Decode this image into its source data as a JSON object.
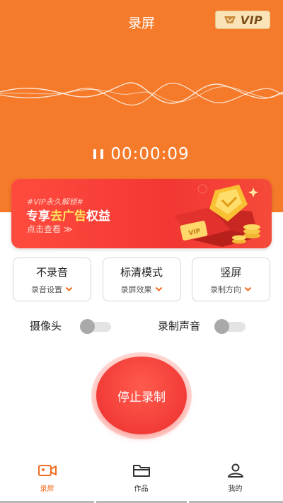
{
  "header": {
    "title": "录屏",
    "vip_label": "VIP"
  },
  "recording": {
    "timer": "00:00:09",
    "state": "paused-icon"
  },
  "banner": {
    "subtitle": "#VIP永久解锁#",
    "title_prefix": "专享",
    "title_highlight": "去广告",
    "title_suffix": "权益",
    "cta": "点击查看 ≫",
    "art_label": "VIP"
  },
  "modes": [
    {
      "title": "不录音",
      "subtitle": "录音设置"
    },
    {
      "title": "标清模式",
      "subtitle": "录屏效果"
    },
    {
      "title": "竖屏",
      "subtitle": "录制方向"
    }
  ],
  "toggles": {
    "camera": {
      "label": "摄像头",
      "on": false
    },
    "audio": {
      "label": "录制声音",
      "on": false
    }
  },
  "stop_button": {
    "label": "停止录制"
  },
  "tabs": [
    {
      "label": "录屏",
      "icon": "video-camera-icon",
      "active": true
    },
    {
      "label": "作品",
      "icon": "folder-icon",
      "active": false
    },
    {
      "label": "我的",
      "icon": "user-icon",
      "active": false
    }
  ],
  "colors": {
    "primary": "#f57a2a",
    "accent": "#f06d20",
    "stop_red": "#f23b37"
  }
}
